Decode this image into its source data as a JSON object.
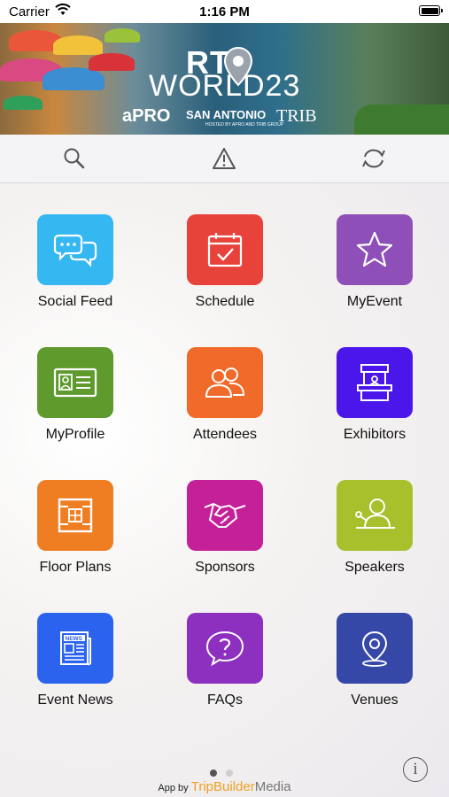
{
  "status_bar": {
    "carrier": "Carrier",
    "time": "1:16 PM"
  },
  "banner": {
    "title_line1": "RT",
    "title_line2": "WORLD23",
    "logo_pro": "aPRO",
    "logo_sa": "SAN ANTONIO",
    "logo_sa_sub": "HOSTED BY APRO AND TRIB GROUP",
    "logo_trib": "TRIB"
  },
  "toolbar": {
    "search_icon": "search-icon",
    "alert_icon": "warning-icon",
    "refresh_icon": "refresh-icon"
  },
  "tiles": [
    {
      "label": "Social Feed",
      "color": "#35b7f2",
      "icon": "chat-bubbles-icon"
    },
    {
      "label": "Schedule",
      "color": "#e8433a",
      "icon": "calendar-check-icon"
    },
    {
      "label": "MyEvent",
      "color": "#8e4fb8",
      "icon": "star-icon"
    },
    {
      "label": "MyProfile",
      "color": "#5f9a2c",
      "icon": "id-card-icon"
    },
    {
      "label": "Attendees",
      "color": "#f06a2a",
      "icon": "people-icon"
    },
    {
      "label": "Exhibitors",
      "color": "#4b16ea",
      "icon": "booth-icon"
    },
    {
      "label": "Floor Plans",
      "color": "#ef7d22",
      "icon": "floor-plan-icon"
    },
    {
      "label": "Sponsors",
      "color": "#c42199",
      "icon": "handshake-icon"
    },
    {
      "label": "Speakers",
      "color": "#a7c02c",
      "icon": "speaker-icon"
    },
    {
      "label": "Event News",
      "color": "#2b63ee",
      "icon": "newspaper-icon"
    },
    {
      "label": "FAQs",
      "color": "#8d2fbf",
      "icon": "question-bubble-icon"
    },
    {
      "label": "Venues",
      "color": "#3548a8",
      "icon": "map-pin-icon"
    }
  ],
  "pager": {
    "active_color": "#555555",
    "inactive_color": "#cfcfcf"
  },
  "footer": {
    "prefix": "App by",
    "brand_a": "TripBuilder",
    "brand_b": "Media"
  },
  "info_button": "i"
}
